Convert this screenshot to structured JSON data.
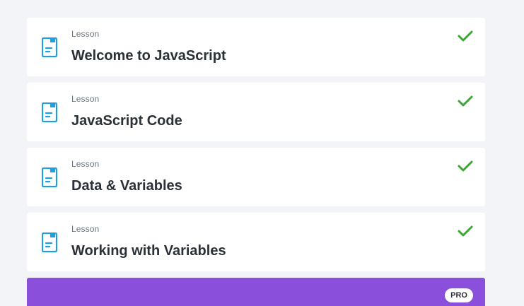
{
  "lessons": [
    {
      "kind": "Lesson",
      "title": "Welcome to JavaScript",
      "completed": true,
      "icon": "document-icon",
      "status_icon": "checkmark-icon"
    },
    {
      "kind": "Lesson",
      "title": "JavaScript Code",
      "completed": true,
      "icon": "document-icon",
      "status_icon": "checkmark-icon"
    },
    {
      "kind": "Lesson",
      "title": "Data & Variables",
      "completed": true,
      "icon": "document-icon",
      "status_icon": "checkmark-icon"
    },
    {
      "kind": "Lesson",
      "title": "Working with Variables",
      "completed": true,
      "icon": "document-icon",
      "status_icon": "checkmark-icon"
    }
  ],
  "pro_card": {
    "badge": "PRO",
    "title": ""
  },
  "colors": {
    "background": "#f2f4f7",
    "card": "#ffffff",
    "icon_blue": "#1ea0e0",
    "check_green": "#3aa832",
    "pro_purple": "#8a4fdb",
    "title_text": "#2b3038",
    "kind_text": "#6b7480"
  }
}
